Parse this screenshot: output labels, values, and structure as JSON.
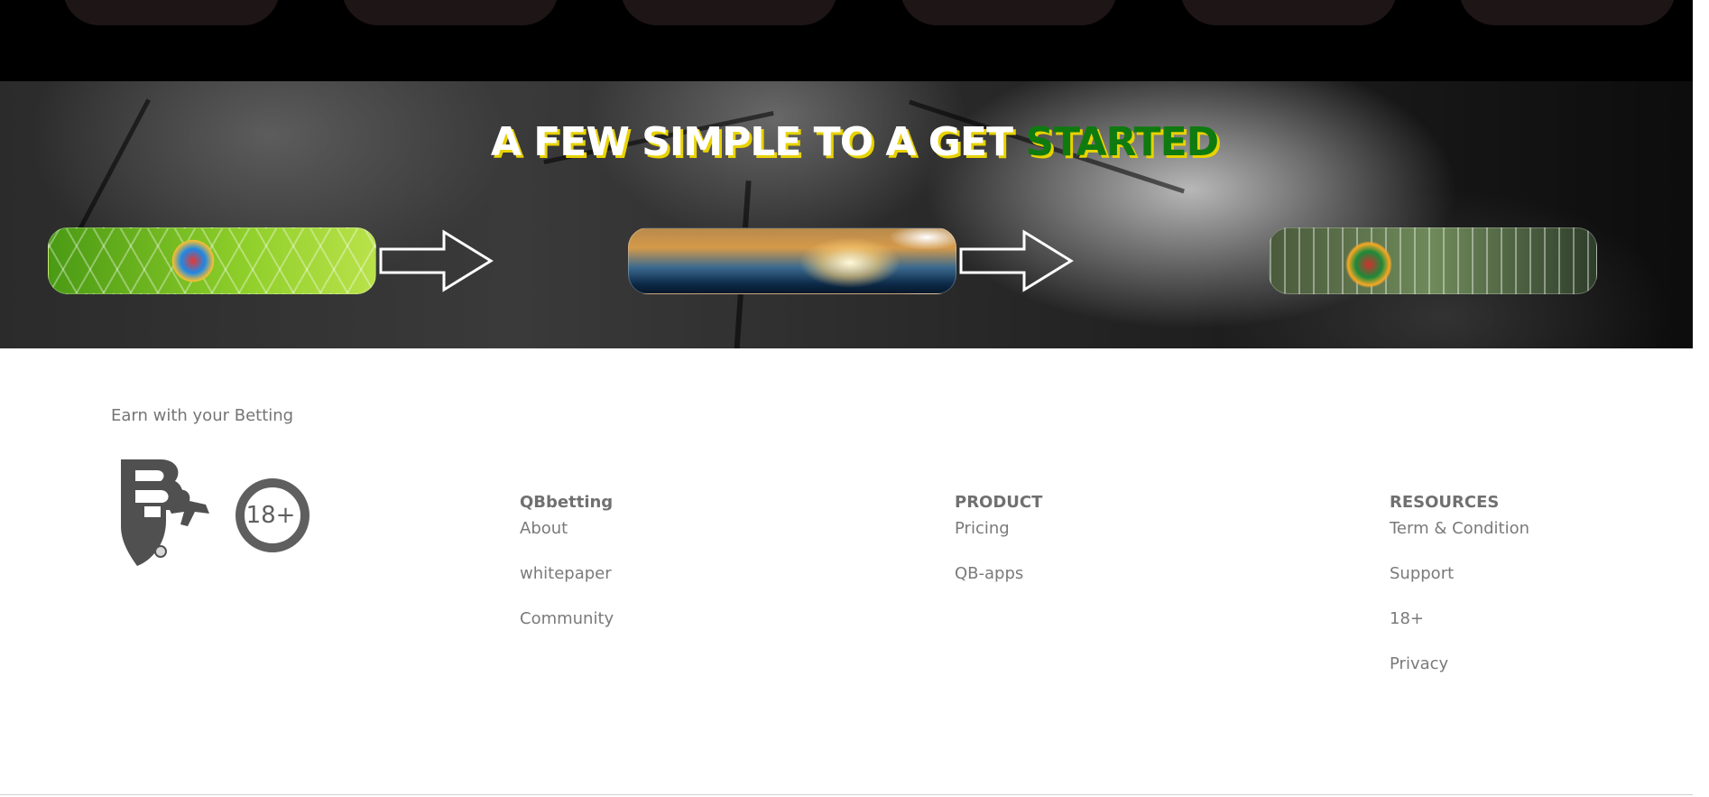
{
  "hero": {
    "title_main": "A FEW SIMPLE TO A GET",
    "title_accent": "STARTED",
    "colors": {
      "title": "#ffffff",
      "accent": "#0f7a0f",
      "shadow": "#e8d200"
    }
  },
  "steps": [
    {
      "icon": "soccer-ball-net-image"
    },
    {
      "icon": "stadium-lights-image"
    },
    {
      "icon": "flag-ball-goal-image"
    }
  ],
  "footer": {
    "tagline": "Earn with your Betting",
    "age_badge": "18+",
    "columns": [
      {
        "heading": "QBbetting",
        "links": [
          "About",
          "whitepaper",
          "Community"
        ]
      },
      {
        "heading": "PRODUCT",
        "links": [
          "Pricing",
          "QB-apps"
        ]
      },
      {
        "heading": "RESOURCES",
        "links": [
          "Term & Condition",
          "Support",
          "18+",
          "Privacy"
        ]
      }
    ]
  }
}
